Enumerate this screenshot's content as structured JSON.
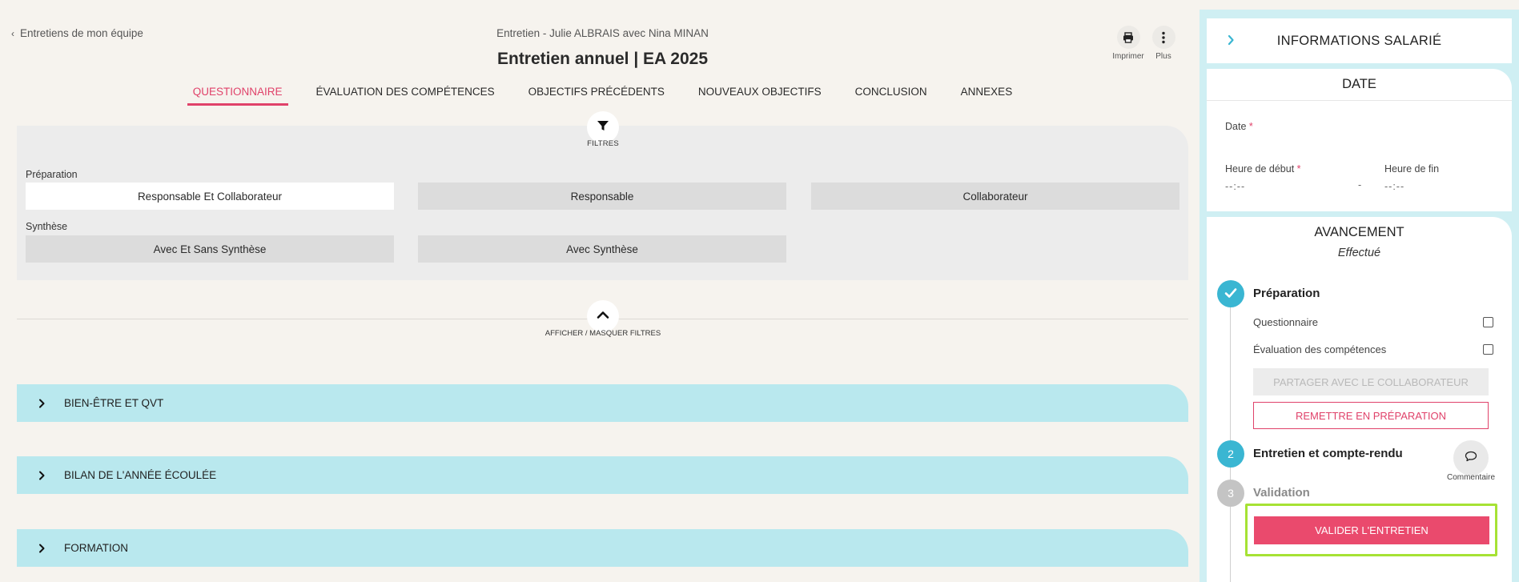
{
  "header": {
    "back_label": "Entretiens de mon équipe",
    "subtitle": "Entretien - Julie ALBRAIS avec Nina MINAN",
    "title": "Entretien annuel | EA 2025",
    "print_label": "Imprimer",
    "more_label": "Plus"
  },
  "tabs": [
    {
      "label": "QUESTIONNAIRE",
      "active": true
    },
    {
      "label": "ÉVALUATION DES COMPÉTENCES",
      "active": false
    },
    {
      "label": "OBJECTIFS PRÉCÉDENTS",
      "active": false
    },
    {
      "label": "NOUVEAUX OBJECTIFS",
      "active": false
    },
    {
      "label": "CONCLUSION",
      "active": false
    },
    {
      "label": "ANNEXES",
      "active": false
    }
  ],
  "filters": {
    "label": "FILTRES",
    "toggle_label": "AFFICHER / MASQUER FILTRES",
    "preparation": {
      "label": "Préparation",
      "options": [
        "Responsable Et Collaborateur",
        "Responsable",
        "Collaborateur"
      ],
      "selected": "Responsable Et Collaborateur"
    },
    "synthese": {
      "label": "Synthèse",
      "options": [
        "Avec Et Sans Synthèse",
        "Avec Synthèse"
      ],
      "selected": "Avec Et Sans Synthèse"
    }
  },
  "sections": [
    {
      "label": "BIEN-ÊTRE ET QVT"
    },
    {
      "label": "BILAN DE L'ANNÉE ÉCOULÉE"
    },
    {
      "label": "FORMATION"
    }
  ],
  "sidebar": {
    "info_title": "INFORMATIONS SALARIÉ",
    "date": {
      "title": "DATE",
      "date_label": "Date",
      "start_label": "Heure de début",
      "end_label": "Heure de fin",
      "start_value": "--:--",
      "end_value": "--:--",
      "separator": "-",
      "required_mark": "*"
    },
    "progress": {
      "title": "AVANCEMENT",
      "status": "Effectué",
      "steps": [
        {
          "number": "1",
          "title": "Préparation",
          "state": "done"
        },
        {
          "number": "2",
          "title": "Entretien et compte-rendu",
          "state": "current"
        },
        {
          "number": "3",
          "title": "Validation",
          "state": "pending"
        }
      ],
      "checks": [
        {
          "label": "Questionnaire",
          "checked": false
        },
        {
          "label": "Évaluation des compétences",
          "checked": false
        }
      ],
      "share_button": "PARTAGER AVEC LE COLLABORATEUR",
      "reprepare_button": "REMETTRE EN PRÉPARATION",
      "comment_label": "Commentaire",
      "validate_button": "VALIDER L'ENTRETIEN"
    }
  },
  "colors": {
    "accent": "#e0426a",
    "primary_button": "#ea4a6d",
    "section_bg": "#b9e8ee",
    "sidebar_bg": "#cfeff3",
    "step_done": "#3ab6d2",
    "step_pending": "#c4c4c4",
    "highlight": "#a6e234"
  }
}
